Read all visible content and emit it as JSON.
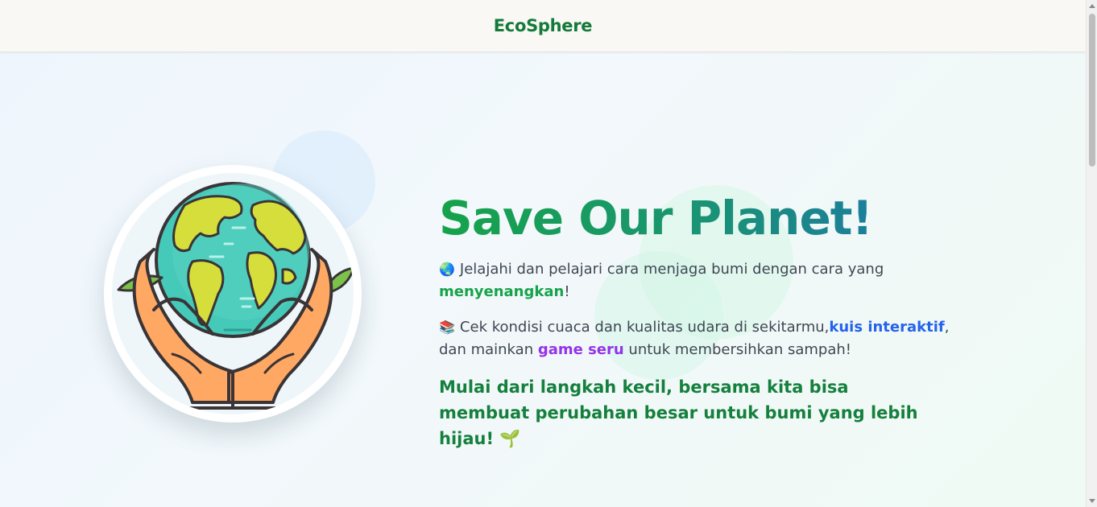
{
  "navbar": {
    "brand": "EcoSphere"
  },
  "hero": {
    "title": "Save Our Planet!",
    "p1": {
      "icon": "🌏",
      "text": "Jelajahi dan pelajari cara menjaga bumi dengan cara yang ",
      "highlight": "menyenangkan",
      "end": "!"
    },
    "p2": {
      "icon": "📚",
      "text1": "Cek kondisi cuaca dan kualitas udara di sekitarmu,",
      "highlight1": "kuis interaktif",
      "text2": ", dan mainkan ",
      "highlight2": "game seru",
      "text3": " untuk membersihkan sampah!"
    },
    "cta": {
      "text": "Mulai dari langkah kecil, bersama kita bisa membuat perubahan besar untuk bumi yang lebih hijau!",
      "icon": "🌱"
    }
  },
  "illustration": {
    "icon": "hands-holding-globe-icon"
  },
  "colors": {
    "brand": "#137a3a",
    "title_gradient_start": "#16a34a",
    "title_gradient_end": "#1e6fb8",
    "highlight_green": "#16a34a",
    "highlight_blue": "#2563eb",
    "highlight_purple": "#9333ea",
    "cta": "#15803d"
  }
}
